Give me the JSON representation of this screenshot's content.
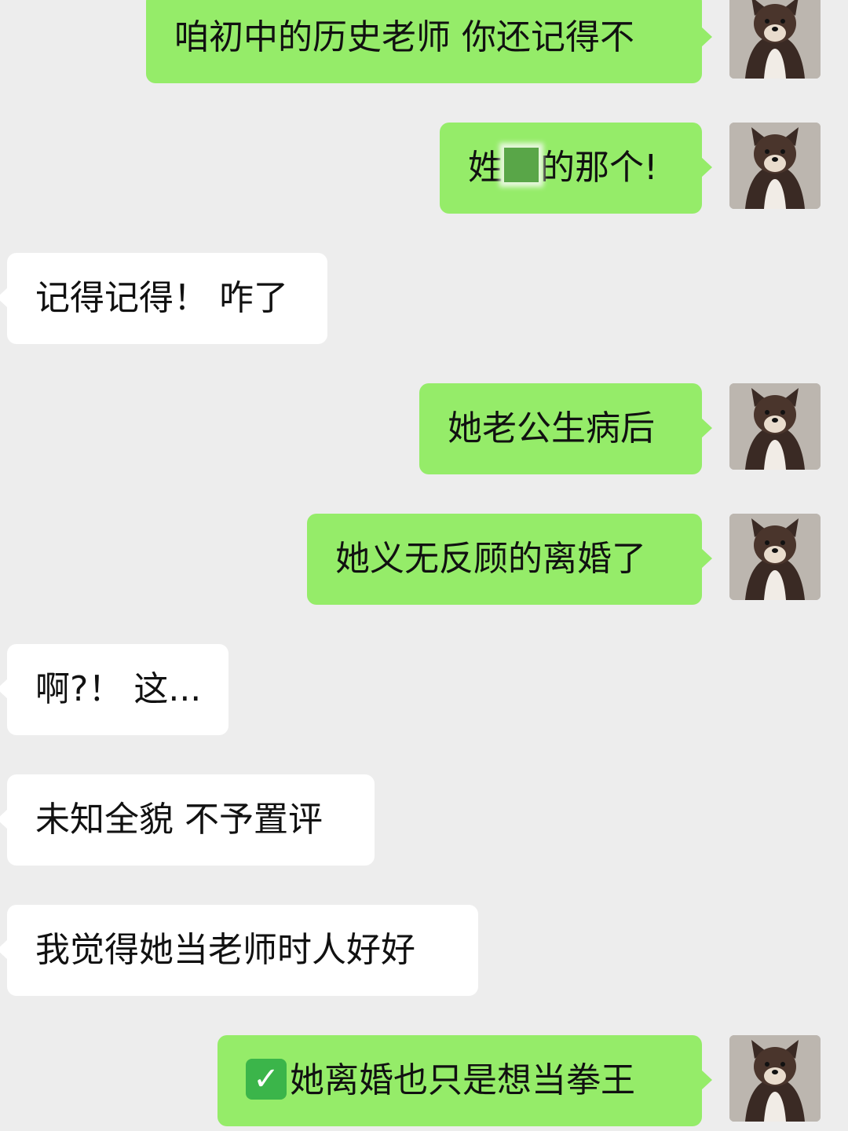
{
  "messages": [
    {
      "side": "sent",
      "text": "咱初中的历史老师 你还记得不"
    },
    {
      "side": "sent",
      "text_before": "姓",
      "text_after": "的那个!",
      "redacted": true
    },
    {
      "side": "recv",
      "text": "记得记得！ 咋了"
    },
    {
      "side": "sent",
      "text": "她老公生病后"
    },
    {
      "side": "sent",
      "text": "她义无反顾的离婚了"
    },
    {
      "side": "recv",
      "text": "啊?！ 这..."
    },
    {
      "side": "recv",
      "text": "未知全貌 不予置评"
    },
    {
      "side": "recv",
      "text": "我觉得她当老师时人好好"
    },
    {
      "side": "sent",
      "icon": "check-mark-emoji-icon",
      "icon_glyph": "✓",
      "text": "她离婚也只是想当拳王"
    }
  ],
  "colors": {
    "background": "#ededed",
    "sent_bubble": "#95ec69",
    "received_bubble": "#ffffff",
    "redaction": "#59a648",
    "check_emoji": "#3bb54a"
  },
  "avatar": {
    "icon": "shiba-dog-avatar"
  }
}
